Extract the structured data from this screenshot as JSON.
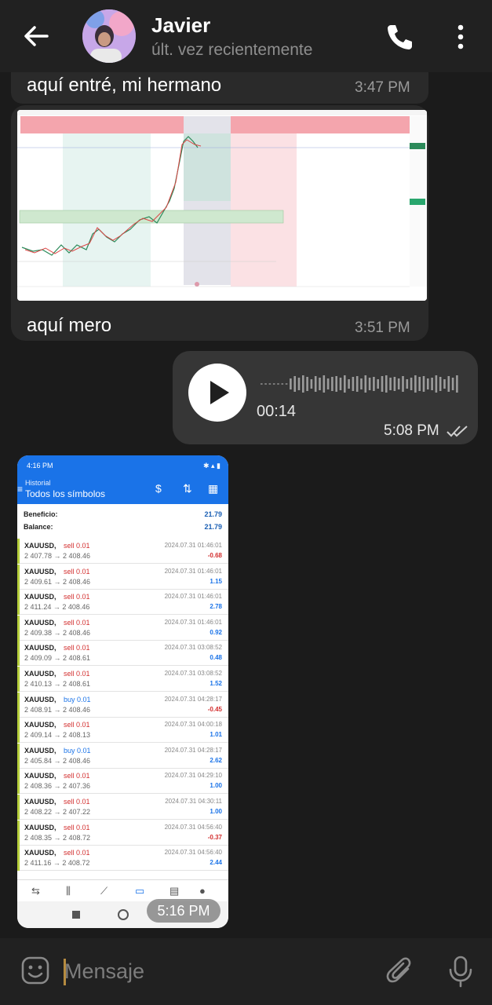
{
  "header": {
    "name": "Javier",
    "status": "últ. vez recientemente"
  },
  "messages": [
    {
      "text": "aquí entré, mi hermano",
      "time": "3:47 PM"
    },
    {
      "text": "aquí mero",
      "time": "3:51 PM"
    }
  ],
  "voice": {
    "duration": "00:14",
    "time": "5:08 PM"
  },
  "screenshot_msg": {
    "time": "5:16 PM",
    "statusbar_time": "4:16 PM",
    "title_small": "Historial",
    "title": "Todos los símbolos",
    "summary": [
      {
        "label": "Beneficio:",
        "value": "21.79"
      },
      {
        "label": "Balance:",
        "value": "21.79"
      }
    ],
    "trades": [
      {
        "symbol": "XAUUSD,",
        "side": "sell 0.01",
        "type": "sell",
        "price": "2 407.78 → 2 408.46",
        "date": "2024.07.31 01:46:01",
        "pl": "-0.68"
      },
      {
        "symbol": "XAUUSD,",
        "side": "sell 0.01",
        "type": "sell",
        "price": "2 409.61 → 2 408.46",
        "date": "2024.07.31 01:46:01",
        "pl": "1.15"
      },
      {
        "symbol": "XAUUSD,",
        "side": "sell 0.01",
        "type": "sell",
        "price": "2 411.24 → 2 408.46",
        "date": "2024.07.31 01:46:01",
        "pl": "2.78"
      },
      {
        "symbol": "XAUUSD,",
        "side": "sell 0.01",
        "type": "sell",
        "price": "2 409.38 → 2 408.46",
        "date": "2024.07.31 01:46:01",
        "pl": "0.92"
      },
      {
        "symbol": "XAUUSD,",
        "side": "sell 0.01",
        "type": "sell",
        "price": "2 409.09 → 2 408.61",
        "date": "2024.07.31 03:08:52",
        "pl": "0.48"
      },
      {
        "symbol": "XAUUSD,",
        "side": "sell 0.01",
        "type": "sell",
        "price": "2 410.13 → 2 408.61",
        "date": "2024.07.31 03:08:52",
        "pl": "1.52"
      },
      {
        "symbol": "XAUUSD,",
        "side": "buy 0.01",
        "type": "buy",
        "price": "2 408.91 → 2 408.46",
        "date": "2024.07.31 04:28:17",
        "pl": "-0.45"
      },
      {
        "symbol": "XAUUSD,",
        "side": "sell 0.01",
        "type": "sell",
        "price": "2 409.14 → 2 408.13",
        "date": "2024.07.31 04:00:18",
        "pl": "1.01"
      },
      {
        "symbol": "XAUUSD,",
        "side": "buy 0.01",
        "type": "buy",
        "price": "2 405.84 → 2 408.46",
        "date": "2024.07.31 04:28:17",
        "pl": "2.62"
      },
      {
        "symbol": "XAUUSD,",
        "side": "sell 0.01",
        "type": "sell",
        "price": "2 408.36 → 2 407.36",
        "date": "2024.07.31 04:29:10",
        "pl": "1.00"
      },
      {
        "symbol": "XAUUSD,",
        "side": "sell 0.01",
        "type": "sell",
        "price": "2 408.22 → 2 407.22",
        "date": "2024.07.31 04:30:11",
        "pl": "1.00"
      },
      {
        "symbol": "XAUUSD,",
        "side": "sell 0.01",
        "type": "sell",
        "price": "2 408.35 → 2 408.72",
        "date": "2024.07.31 04:56:40",
        "pl": "-0.37"
      },
      {
        "symbol": "XAUUSD,",
        "side": "sell 0.01",
        "type": "sell",
        "price": "2 411.16 → 2 408.72",
        "date": "2024.07.31 04:56:40",
        "pl": "2.44"
      }
    ]
  },
  "composer": {
    "placeholder": "Mensaje"
  },
  "colors": {
    "accent": "#1a73e8",
    "sell": "#d32f2f",
    "chat_bg": "#1b1b1b",
    "bubble_in": "#2a2a2a",
    "bubble_out": "#363636"
  }
}
